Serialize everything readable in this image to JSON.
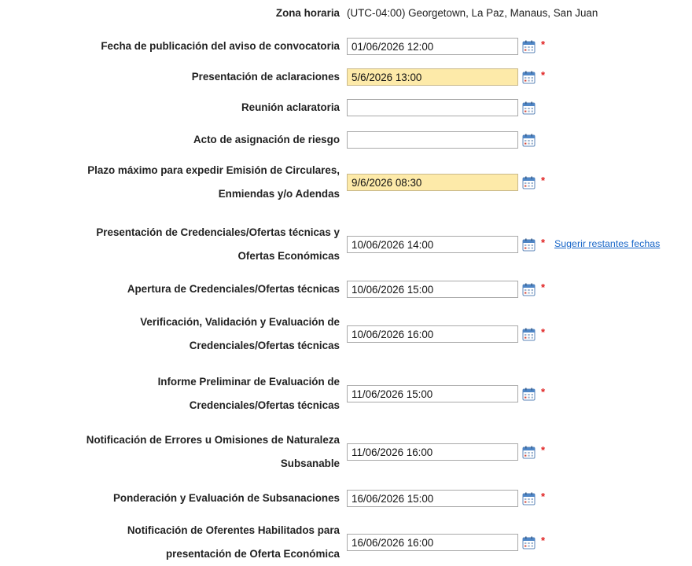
{
  "timezone": {
    "label": "Zona horaria",
    "value": "(UTC-04:00) Georgetown, La Paz, Manaus, San Juan"
  },
  "fields": [
    {
      "label_lines": [
        "Fecha de publicación del aviso de convocatoria"
      ],
      "value": "01/06/2026 12:00",
      "required": true,
      "highlighted": false
    },
    {
      "label_lines": [
        "Presentación de aclaraciones"
      ],
      "value": "5/6/2026 13:00",
      "required": true,
      "highlighted": true
    },
    {
      "label_lines": [
        "Reunión aclaratoria"
      ],
      "value": "",
      "required": false,
      "highlighted": false
    },
    {
      "label_lines": [
        "Acto de asignación de riesgo"
      ],
      "value": "",
      "required": false,
      "highlighted": false
    },
    {
      "label_lines": [
        "Plazo máximo para expedir Emisión de Circulares,",
        "Enmiendas y/o Adendas"
      ],
      "value": "9/6/2026 08:30",
      "required": true,
      "highlighted": true
    },
    {
      "label_lines": [
        "Presentación de Credenciales/Ofertas técnicas y",
        "Ofertas Económicas"
      ],
      "value": "10/06/2026 14:00",
      "required": true,
      "highlighted": false,
      "link": "Sugerir restantes fechas"
    },
    {
      "label_lines": [
        "Apertura de Credenciales/Ofertas técnicas"
      ],
      "value": "10/06/2026 15:00",
      "required": true,
      "highlighted": false
    },
    {
      "label_lines": [
        "Verificación, Validación y Evaluación de",
        "Credenciales/Ofertas técnicas"
      ],
      "value": "10/06/2026 16:00",
      "required": true,
      "highlighted": false
    },
    {
      "label_lines": [
        "Informe Preliminar de Evaluación de",
        "Credenciales/Ofertas técnicas"
      ],
      "value": "11/06/2026 15:00",
      "required": true,
      "highlighted": false
    },
    {
      "label_lines": [
        "Notificación de Errores u Omisiones de Naturaleza",
        "Subsanable"
      ],
      "value": "11/06/2026 16:00",
      "required": true,
      "highlighted": false
    },
    {
      "label_lines": [
        "Ponderación y Evaluación de Subsanaciones"
      ],
      "value": "16/06/2026 15:00",
      "required": true,
      "highlighted": false
    },
    {
      "label_lines": [
        "Notificación de Oferentes Habilitados para",
        "presentación de Oferta Económica"
      ],
      "value": "16/06/2026 16:00",
      "required": true,
      "highlighted": false
    }
  ],
  "required_marker": "*",
  "icons": {
    "calendar": "calendar-icon"
  },
  "colors": {
    "highlight": "#fdeaa9",
    "required": "#e02020",
    "link": "#1a67c8"
  }
}
